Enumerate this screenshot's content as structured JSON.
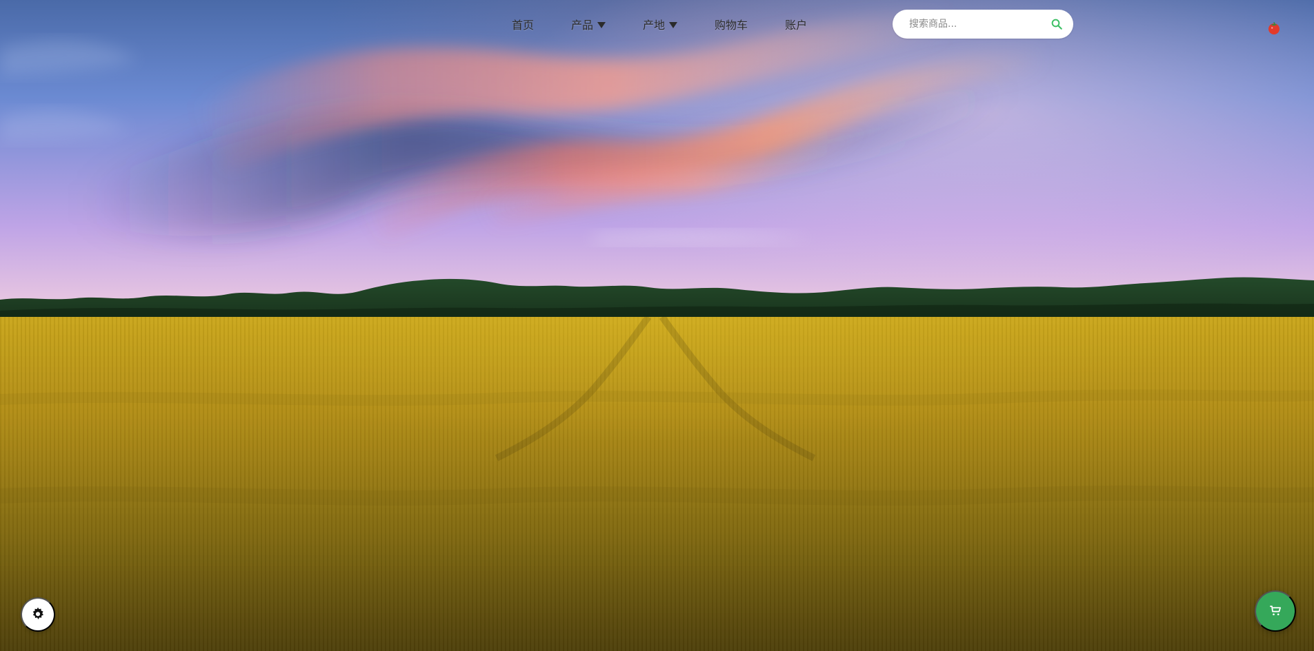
{
  "nav": {
    "links": [
      {
        "label": "首页",
        "has_dropdown": false
      },
      {
        "label": "产品",
        "has_dropdown": true
      },
      {
        "label": "产地",
        "has_dropdown": true
      },
      {
        "label": "购物车",
        "has_dropdown": false
      },
      {
        "label": "账户",
        "has_dropdown": false
      }
    ]
  },
  "search": {
    "placeholder": "搜索商品...",
    "value": "",
    "icon": "search-icon",
    "icon_color": "#3bbf63"
  },
  "brand": {
    "icon": "tomato-icon",
    "colors": {
      "fruit": "#e23a2a",
      "leaf": "#2a8f3f"
    }
  },
  "floating_buttons": {
    "left": {
      "icon": "gear-icon",
      "background": "#ffffff",
      "icon_color": "#111111"
    },
    "right": {
      "icon": "cart-icon",
      "background": "#35a85a",
      "icon_color": "#ffffff"
    }
  }
}
